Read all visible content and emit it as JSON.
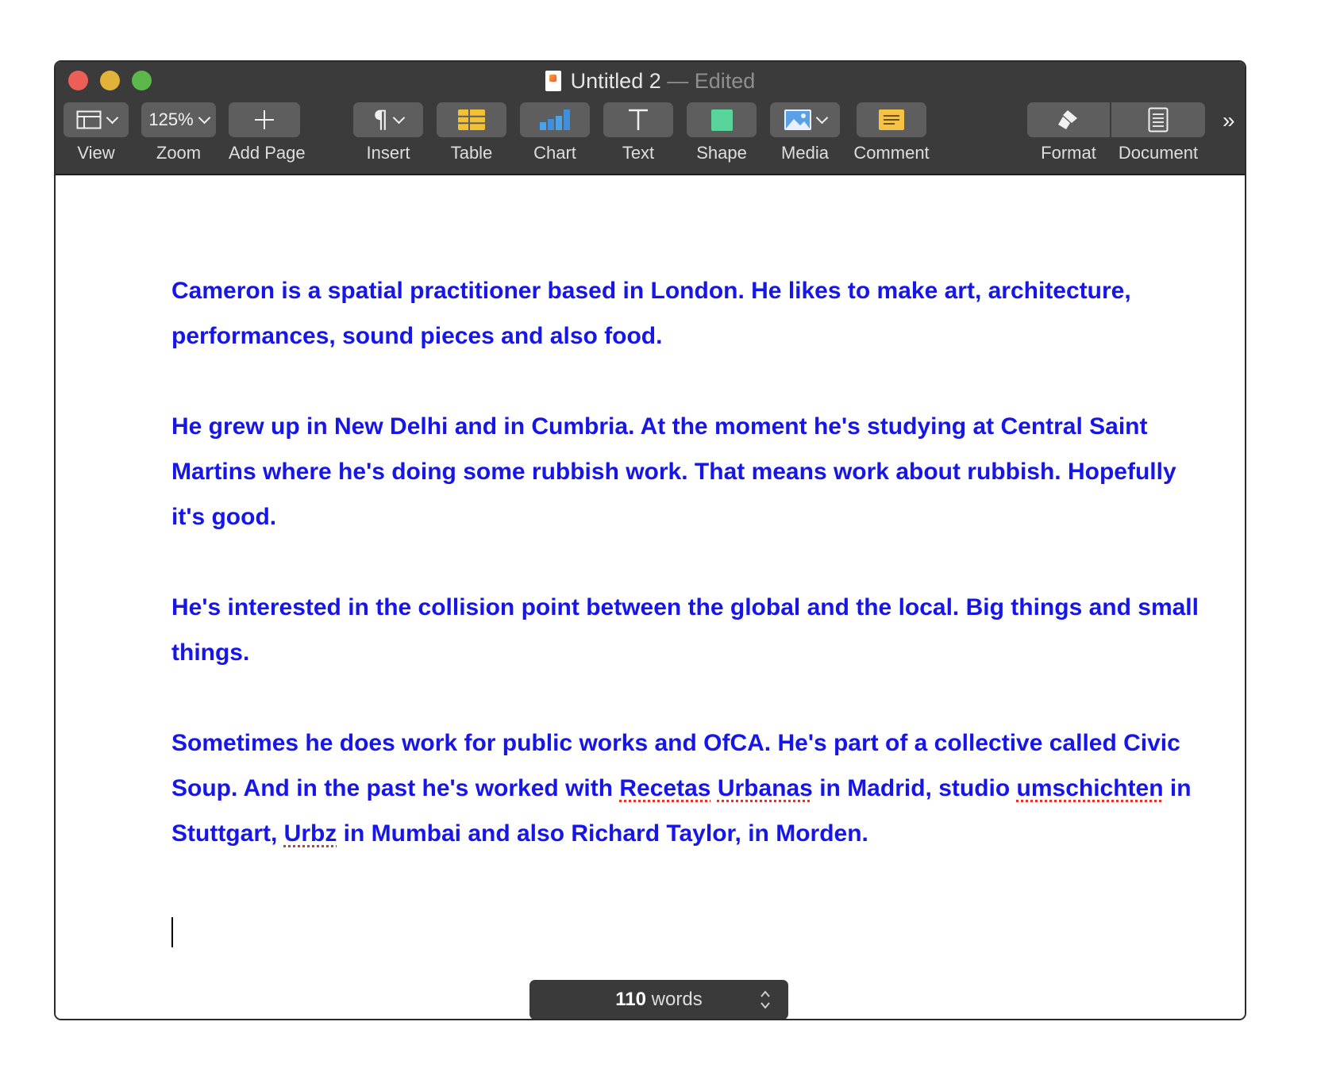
{
  "window": {
    "title": "Untitled 2",
    "title_suffix": "— Edited"
  },
  "toolbar": {
    "view_label": "View",
    "zoom_value": "125%",
    "zoom_label": "Zoom",
    "add_page_label": "Add Page",
    "insert_label": "Insert",
    "table_label": "Table",
    "chart_label": "Chart",
    "text_label": "Text",
    "shape_label": "Shape",
    "media_label": "Media",
    "comment_label": "Comment",
    "format_label": "Format",
    "document_label": "Document",
    "more_icon": "»"
  },
  "document": {
    "p1": "Cameron is a spatial practitioner based in London. He likes to make art, architecture, performances, sound pieces and also food.",
    "p2": "He grew up in New Delhi and in Cumbria. At the moment he's studying at Central Saint Martins where he's doing some rubbish work. That means work about rubbish. Hopefully it's good.",
    "p3": "He's interested in the collision point between the global and the local. Big things and small things.",
    "p4": {
      "a": "Sometimes he does work for public works and OfCA. He's part of a collective called Civic Soup. And in the past he's worked with ",
      "b": "Recetas",
      "c": " ",
      "d": "Urbanas",
      "e": " in Madrid, studio ",
      "f": "umschichten",
      "g": " in Stuttgart, ",
      "h": "Urbz",
      "i": " in Mumbai and also Richard Taylor, in Morden."
    }
  },
  "status": {
    "word_count": "110",
    "word_unit": "words"
  },
  "colors": {
    "text": "#1616e8",
    "toolbar_bg": "#3b3b3b",
    "button_bg": "#5e5e5e",
    "spell_underline": "#e0352b"
  }
}
